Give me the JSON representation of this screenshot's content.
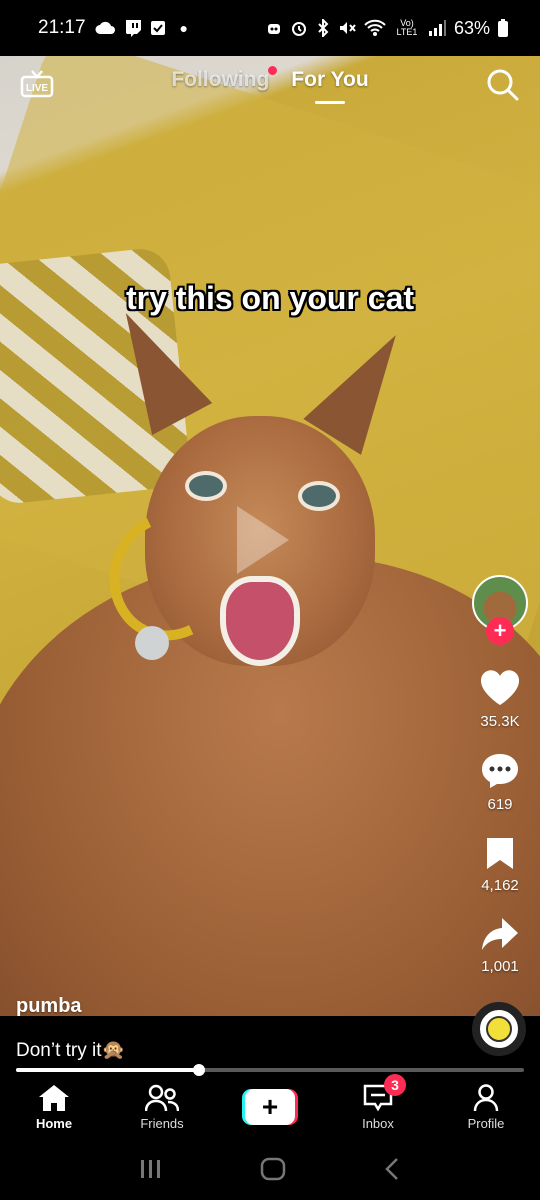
{
  "status_bar": {
    "time": "21:17",
    "left_icons": [
      "cloud-icon",
      "twitch-icon",
      "checkbox-icon",
      "dot-icon"
    ],
    "right_icons": [
      "robot-icon",
      "alarm-icon",
      "bluetooth-icon",
      "mute-icon",
      "wifi-icon",
      "volte-icon",
      "signal-icon"
    ],
    "volte": "Vo) LTE1",
    "battery": "63%"
  },
  "top_nav": {
    "live_label": "LIVE",
    "tabs": [
      {
        "label": "Following",
        "active": false,
        "has_dot": true
      },
      {
        "label": "For You",
        "active": true
      }
    ]
  },
  "video": {
    "overlay_text": "try this on your cat"
  },
  "rail": {
    "likes": "35.3K",
    "comments": "619",
    "bookmarks": "4,162",
    "shares": "1,001",
    "follow_symbol": "+"
  },
  "post": {
    "username": "pumba",
    "description": "Don’t try it🙊",
    "progress": 0.36
  },
  "bottom_nav": {
    "items": [
      {
        "label": "Home",
        "active": true
      },
      {
        "label": "Friends"
      },
      {
        "label": "+",
        "is_create": true
      },
      {
        "label": "Inbox",
        "badge": "3"
      },
      {
        "label": "Profile"
      }
    ]
  },
  "colors": {
    "accent": "#fe2c55",
    "cyan": "#25f4ee"
  }
}
